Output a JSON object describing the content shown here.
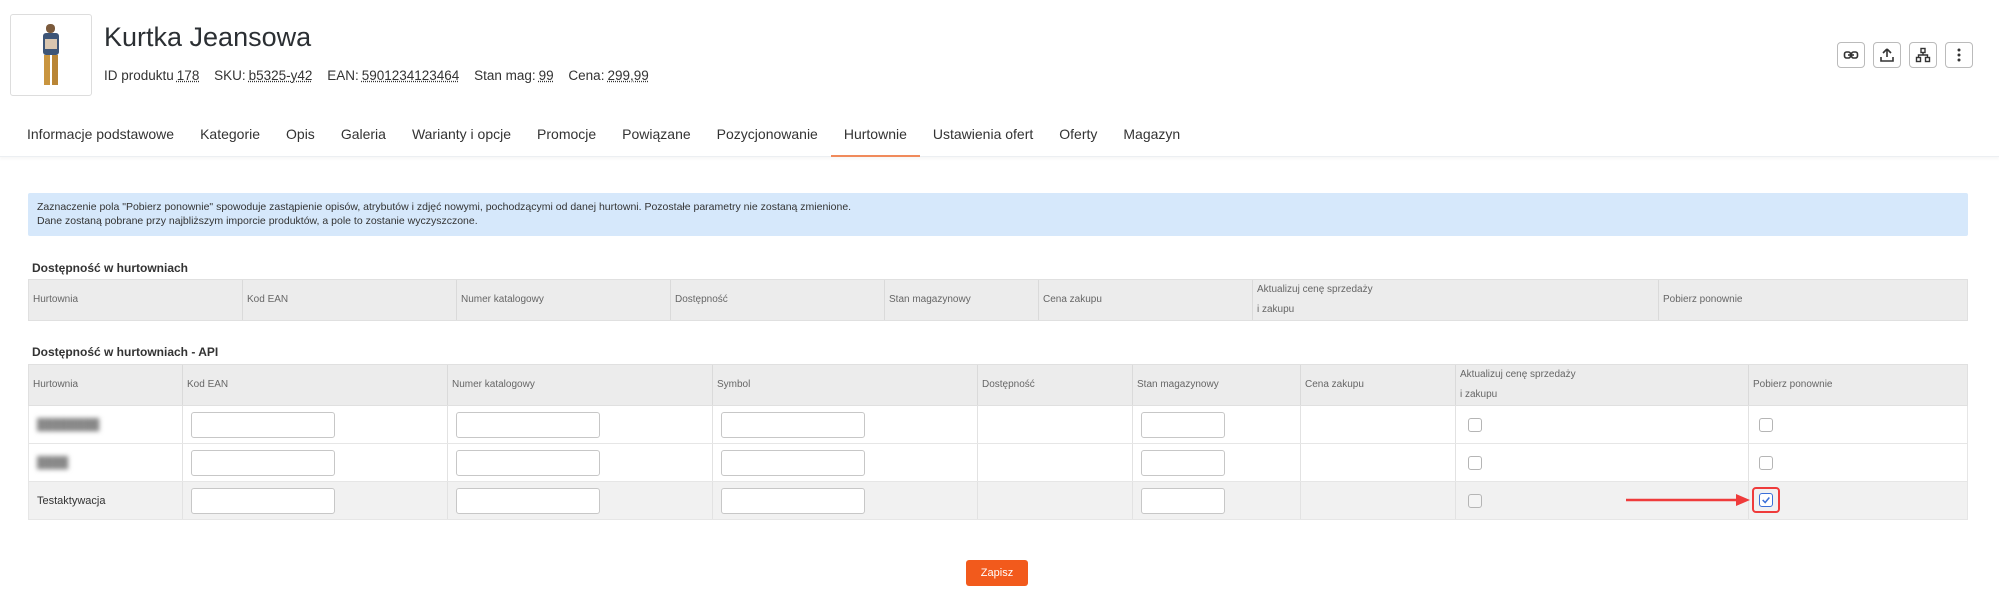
{
  "product": {
    "title": "Kurtka Jeansowa",
    "meta": [
      {
        "label": "ID produktu",
        "value": "178"
      },
      {
        "label": "SKU:",
        "value": "b5325-y42"
      },
      {
        "label": "EAN:",
        "value": "5901234123464"
      },
      {
        "label": "Stan mag:",
        "value": "99"
      },
      {
        "label": "Cena:",
        "value": "299,99"
      }
    ]
  },
  "actions": [
    "link-icon",
    "upload-icon",
    "sitemap-icon",
    "more-vertical-icon"
  ],
  "tabs": [
    "Informacje podstawowe",
    "Kategorie",
    "Opis",
    "Galeria",
    "Warianty i opcje",
    "Promocje",
    "Powiązane",
    "Pozycjonowanie",
    "Hurtownie",
    "Ustawienia ofert",
    "Oferty",
    "Magazyn"
  ],
  "active_tab": "Hurtownie",
  "info": {
    "line1": "Zaznaczenie pola \"Pobierz ponownie\" spowoduje zastąpienie opisów, atrybutów i zdjęć nowymi, pochodzącymi od danej hurtowni. Pozostałe parametry nie zostaną zmienione.",
    "line2": "Dane zostaną pobrane przy najbliższym imporcie produktów, a pole to zostanie wyczyszczone."
  },
  "table1": {
    "title": "Dostępność w hurtowniach",
    "headers": [
      "Hurtownia",
      "Kod EAN",
      "Numer katalogowy",
      "Dostępność",
      "Stan magazynowy",
      "Cena zakupu",
      "Aktualizuj cenę sprzedaży i zakupu",
      "Pobierz ponownie"
    ]
  },
  "table2": {
    "title": "Dostępność w hurtowniach - API",
    "headers": [
      "Hurtownia",
      "Kod EAN",
      "Numer katalogowy",
      "Symbol",
      "Dostępność",
      "Stan magazynowy",
      "Cena zakupu",
      "Aktualizuj cenę sprzedaży i zakupu",
      "Pobierz ponownie"
    ],
    "rows": [
      {
        "name": "",
        "update_price": false,
        "fetch_again": false
      },
      {
        "name": "",
        "update_price": false,
        "fetch_again": false
      },
      {
        "name": "Testaktywacja",
        "update_price": false,
        "fetch_again": true
      }
    ]
  },
  "save_label": "Zapisz",
  "colors": {
    "accent": "#f25a1c",
    "info_bg": "#d6e8fb",
    "highlight": "#ef3b3b"
  }
}
